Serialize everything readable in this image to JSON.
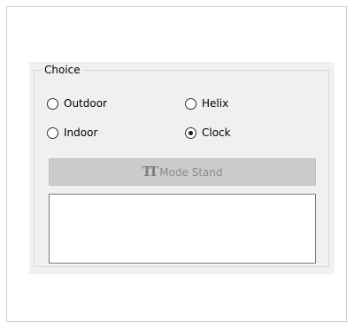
{
  "group": {
    "title": "Choice"
  },
  "radios": [
    {
      "label": "Outdoor",
      "checked": false
    },
    {
      "label": "Helix",
      "checked": false
    },
    {
      "label": "Indoor",
      "checked": false
    },
    {
      "label": "Clock",
      "checked": true
    }
  ],
  "mode_button": {
    "label": "Mode Stand",
    "icon": "text-tt-icon",
    "enabled": false
  },
  "text_area": {
    "value": ""
  }
}
